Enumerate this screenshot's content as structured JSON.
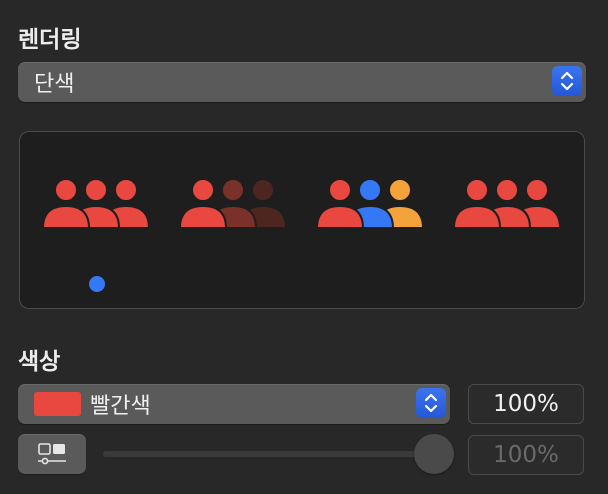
{
  "rendering": {
    "title": "렌더링",
    "mode_value": "단색",
    "previews": [
      {
        "name": "monochrome",
        "colors": [
          "#e8483f",
          "#e8483f",
          "#e8483f"
        ],
        "selected": true
      },
      {
        "name": "hierarchical",
        "colors": [
          "#e8483f",
          "#7a3129",
          "#4d2620"
        ],
        "selected": false
      },
      {
        "name": "palette",
        "colors": [
          "#e8483f",
          "#3478f6",
          "#f3a33a"
        ],
        "selected": false
      },
      {
        "name": "multicolor",
        "colors": [
          "#e8483f",
          "#e8483f",
          "#e8483f"
        ],
        "selected": false
      }
    ]
  },
  "color": {
    "title": "색상",
    "swatch_color": "#e8483f",
    "value": "빨간색",
    "opacity": "100%",
    "secondary_opacity": "100%",
    "secondary_slider_level": 1.0
  },
  "icons": {
    "stepper": "chevron-up-down-icon",
    "people": "person-3-fill-icon",
    "style_toggle": "layout-toggle-icon"
  },
  "accent": "#3478f6"
}
